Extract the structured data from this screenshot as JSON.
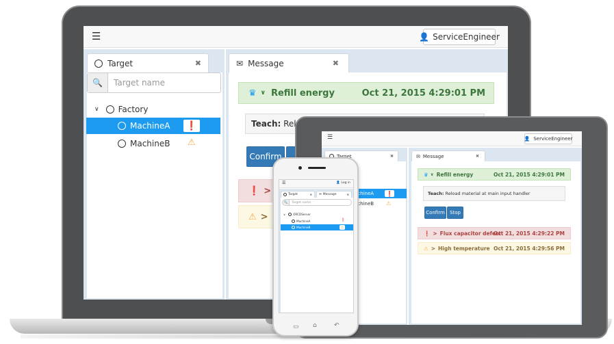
{
  "app": {
    "user": "ServiceEngineer",
    "phone_user": "Log in"
  },
  "tabs": {
    "target": "Target",
    "message": "Message"
  },
  "search": {
    "placeholder": "Target name"
  },
  "tree": {
    "root": "Factory",
    "phone_root": "ORCDServer",
    "items": [
      "MachineA",
      "MachineB"
    ]
  },
  "message": {
    "title": "Refill energy",
    "timestamp": "Oct 21, 2015 4:29:01 PM",
    "teach_label": "Teach:",
    "teach_text": "Reload material at main input handler",
    "teach_text_laptop": "Reload",
    "confirm": "Confirm",
    "stop": "Stop"
  },
  "alerts": [
    {
      "title": "Flux capacitor defect",
      "timestamp": "Oct 21, 2015 4:29:22 PM",
      "level": "error"
    },
    {
      "title": "High temperature",
      "timestamp": "Oct 21, 2015 4:29:56 PM",
      "level": "warning"
    }
  ],
  "colors": {
    "selected": "#1d9bf0",
    "success": "#3c763d",
    "danger": "#d9534f",
    "warning": "#f0ad4e",
    "primary": "#337ab7"
  },
  "icons": {
    "menu": "hamburger-icon",
    "user": "user-icon",
    "target": "target-icon",
    "message": "envelope-icon",
    "search": "search-icon",
    "close": "close-icon",
    "error": "exclamation-circle-icon",
    "warning": "warning-triangle-icon",
    "expand": "chevron-down-icon",
    "collapsed": "chevron-right-icon",
    "robot": "robot-icon"
  }
}
